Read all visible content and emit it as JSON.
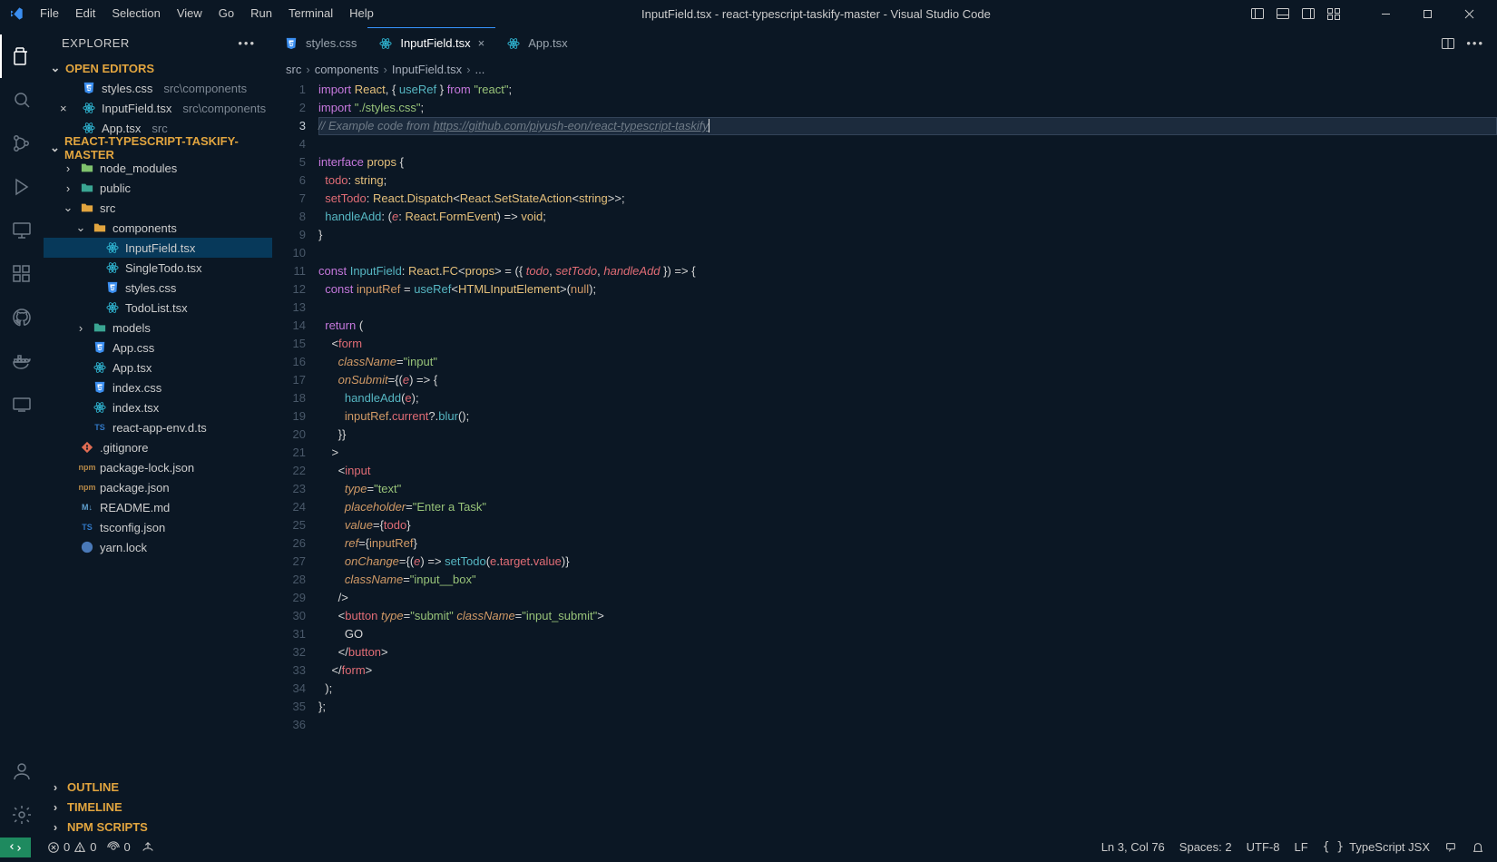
{
  "title": "InputField.tsx - react-typescript-taskify-master - Visual Studio Code",
  "menu": [
    "File",
    "Edit",
    "Selection",
    "View",
    "Go",
    "Run",
    "Terminal",
    "Help"
  ],
  "explorer": {
    "title": "EXPLORER",
    "openEditors": "OPEN EDITORS",
    "project": "REACT-TYPESCRIPT-TASKIFY-MASTER",
    "openFiles": [
      {
        "name": "styles.css",
        "hint": "src\\components",
        "icon": "css"
      },
      {
        "name": "InputField.tsx",
        "hint": "src\\components",
        "icon": "react",
        "active": true
      },
      {
        "name": "App.tsx",
        "hint": "src",
        "icon": "react"
      }
    ],
    "tree": [
      {
        "name": "node_modules",
        "type": "folder",
        "icon": "folder-green",
        "indent": 1,
        "expanded": false
      },
      {
        "name": "public",
        "type": "folder",
        "icon": "folder-teal",
        "indent": 1,
        "expanded": false
      },
      {
        "name": "src",
        "type": "folder",
        "icon": "folder",
        "indent": 1,
        "expanded": true
      },
      {
        "name": "components",
        "type": "folder",
        "icon": "folder",
        "indent": 2,
        "expanded": true
      },
      {
        "name": "InputField.tsx",
        "type": "file",
        "icon": "react",
        "indent": 3,
        "active": true
      },
      {
        "name": "SingleTodo.tsx",
        "type": "file",
        "icon": "react",
        "indent": 3
      },
      {
        "name": "styles.css",
        "type": "file",
        "icon": "css",
        "indent": 3
      },
      {
        "name": "TodoList.tsx",
        "type": "file",
        "icon": "react",
        "indent": 3
      },
      {
        "name": "models",
        "type": "folder",
        "icon": "folder-teal",
        "indent": 2,
        "expanded": false
      },
      {
        "name": "App.css",
        "type": "file",
        "icon": "css",
        "indent": 2
      },
      {
        "name": "App.tsx",
        "type": "file",
        "icon": "react",
        "indent": 2
      },
      {
        "name": "index.css",
        "type": "file",
        "icon": "css",
        "indent": 2
      },
      {
        "name": "index.tsx",
        "type": "file",
        "icon": "react",
        "indent": 2
      },
      {
        "name": "react-app-env.d.ts",
        "type": "file",
        "icon": "ts",
        "indent": 2
      },
      {
        "name": ".gitignore",
        "type": "file",
        "icon": "git",
        "indent": 1
      },
      {
        "name": "package-lock.json",
        "type": "file",
        "icon": "json",
        "indent": 1
      },
      {
        "name": "package.json",
        "type": "file",
        "icon": "json",
        "indent": 1
      },
      {
        "name": "README.md",
        "type": "file",
        "icon": "md",
        "indent": 1
      },
      {
        "name": "tsconfig.json",
        "type": "file",
        "icon": "ts",
        "indent": 1
      },
      {
        "name": "yarn.lock",
        "type": "file",
        "icon": "yarn",
        "indent": 1
      }
    ],
    "collapsed": [
      "OUTLINE",
      "TIMELINE",
      "NPM SCRIPTS"
    ]
  },
  "tabs": [
    {
      "name": "styles.css",
      "icon": "css"
    },
    {
      "name": "InputField.tsx",
      "icon": "react",
      "active": true
    },
    {
      "name": "App.tsx",
      "icon": "react"
    }
  ],
  "breadcrumb": [
    "src",
    "components",
    "InputField.tsx",
    "..."
  ],
  "code": {
    "lines": 36,
    "current": 3
  },
  "status": {
    "errors": "0",
    "warnings": "0",
    "ports": "0",
    "lncol": "Ln 3, Col 76",
    "spaces": "Spaces: 2",
    "enc": "UTF-8",
    "eol": "LF",
    "lang": "TypeScript JSX"
  }
}
